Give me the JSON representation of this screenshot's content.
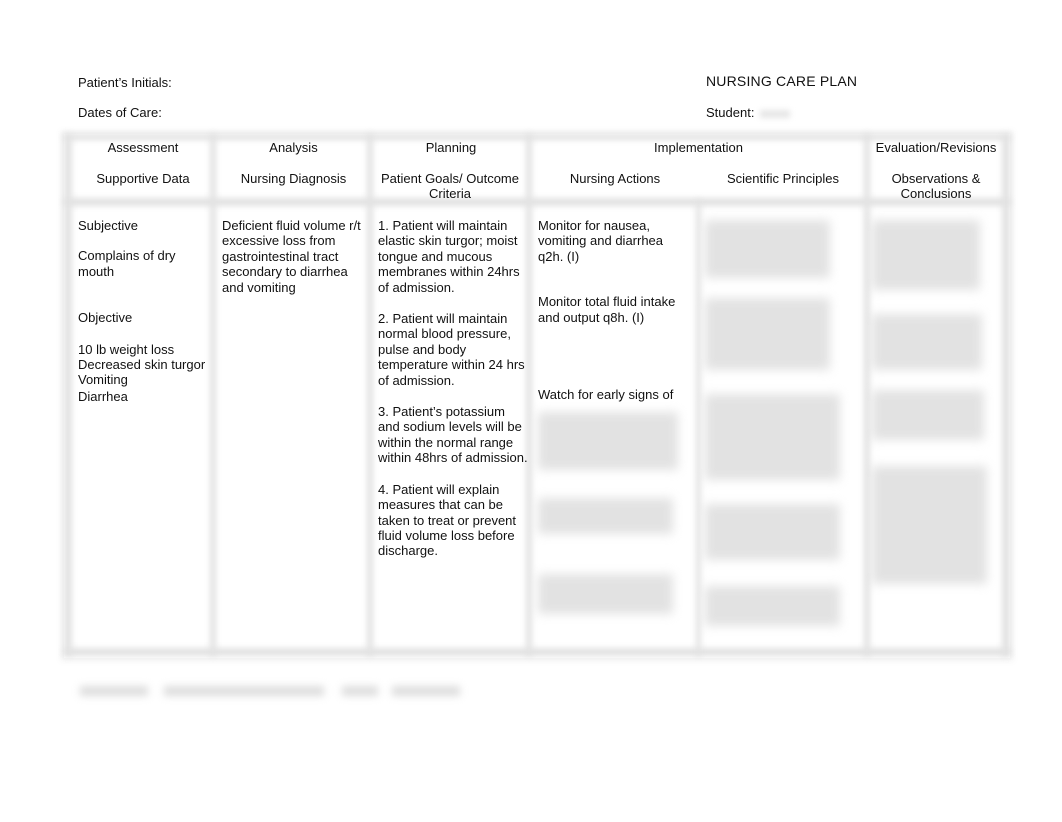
{
  "header": {
    "patient_initials_label": "Patient’s Initials:",
    "dates_of_care_label": "Dates of Care:",
    "title": "NURSING CARE PLAN",
    "student_label": "Student:"
  },
  "table": {
    "top_headers": {
      "assessment": "Assessment",
      "analysis": "Analysis",
      "planning": "Planning",
      "implementation": "Implementation",
      "evaluation": "Evaluation/Revisions"
    },
    "sub_headers": {
      "supportive_data": "Supportive Data",
      "nursing_diagnosis": "Nursing Diagnosis",
      "patient_goals": "Patient Goals/ Outcome Criteria",
      "nursing_actions": "Nursing Actions",
      "scientific_principles": "Scientific Principles",
      "observations": "Observations & Conclusions"
    },
    "assessment": {
      "subjective_heading": "Subjective",
      "subjective_items": [
        "Complains of dry mouth"
      ],
      "objective_heading": "Objective",
      "objective_items": [
        "10 lb weight loss",
        "Decreased skin turgor",
        "Vomiting",
        "Diarrhea"
      ]
    },
    "diagnosis": "Deficient fluid volume r/t excessive loss from gastrointestinal tract secondary to diarrhea and vomiting",
    "goals": [
      "1. Patient will maintain elastic skin turgor; moist tongue and mucous membranes within 24hrs of admission.",
      "2. Patient will maintain normal blood pressure, pulse and body temperature within 24 hrs of admission.",
      "3. Patient’s potassium and sodium levels will be within the normal range within 48hrs of admission.",
      "4. Patient will explain measures that can be taken to treat or prevent fluid volume loss before discharge."
    ],
    "nursing_actions": [
      "Monitor for nausea, vomiting and diarrhea q2h. (I)",
      "Monitor total fluid intake and output q8h. (I)",
      "Watch for early signs of"
    ]
  }
}
